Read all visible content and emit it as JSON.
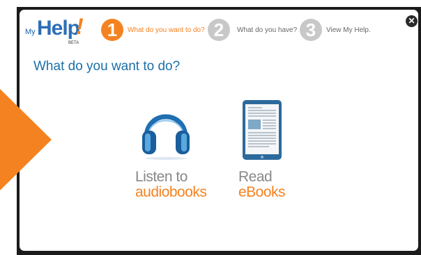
{
  "logo": {
    "my": "My",
    "help": "Help",
    "bang": "!",
    "beta": "BETA"
  },
  "steps": [
    {
      "number": "1",
      "label": "What do you want to do?"
    },
    {
      "number": "2",
      "label": "What do you have?"
    },
    {
      "number": "3",
      "label": "View My Help."
    }
  ],
  "heading": "What do you want to do?",
  "options": {
    "audiobooks": {
      "line1": "Listen to",
      "line2": "audiobooks"
    },
    "ebooks": {
      "line1": "Read",
      "line2": "eBooks"
    }
  },
  "close": {
    "glyph": "✕"
  },
  "colors": {
    "accent": "#f58220",
    "brand_blue": "#1a6fa8",
    "inactive_step": "#c8c8c8"
  },
  "icons": [
    "headphones-icon",
    "tablet-ebook-icon",
    "close-icon"
  ]
}
